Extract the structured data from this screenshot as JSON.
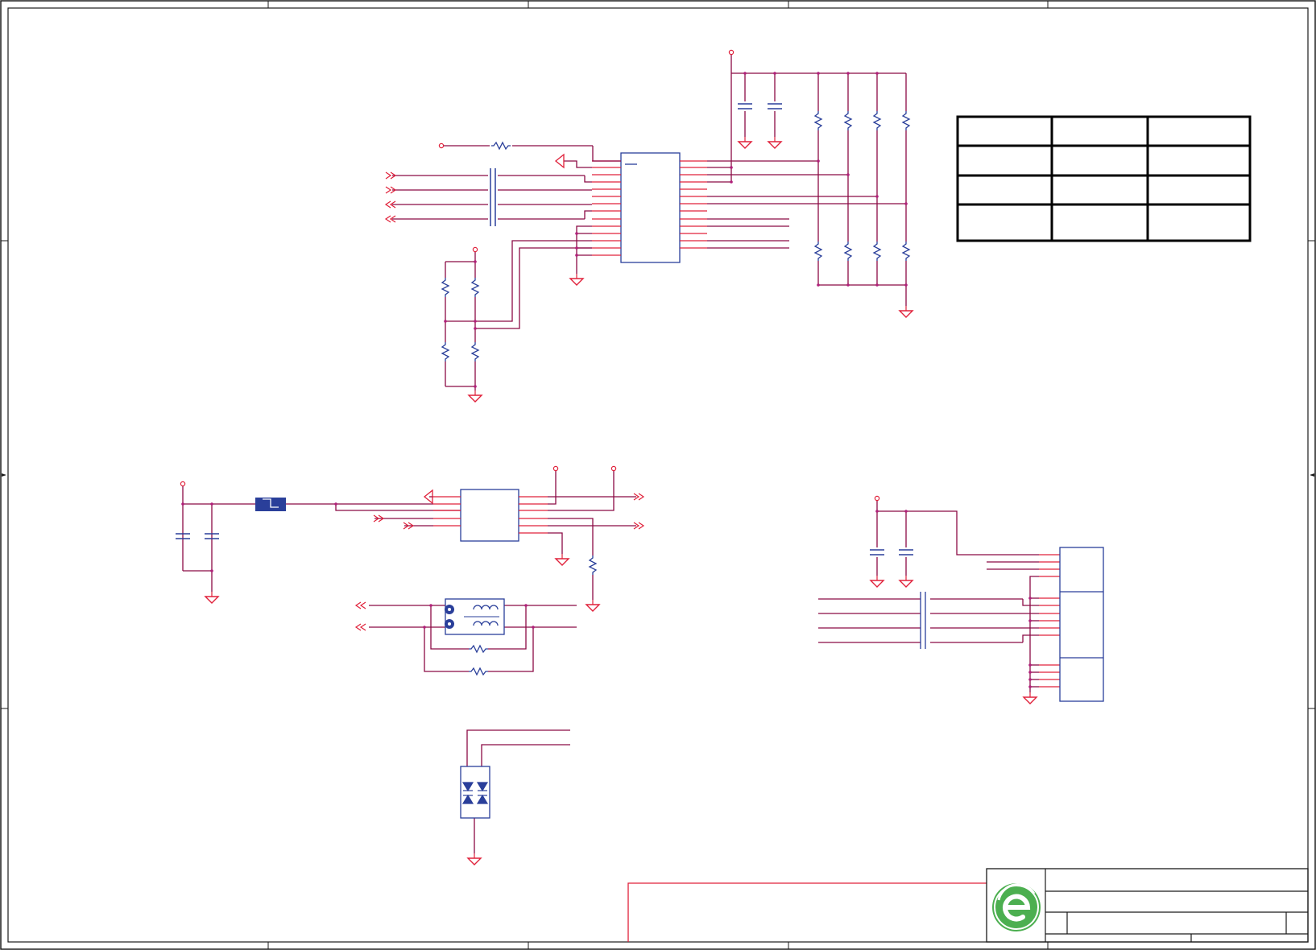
{
  "sheet": {
    "title": "",
    "frame_color": "#1a1a1a",
    "wire_color": "#8b0a45",
    "pin_color": "#e0203a",
    "component_color": "#2a3f9a",
    "junction_color": "#b0207a",
    "logo_color": "#4caf50"
  },
  "blocks": {
    "top_ic": "ic-u1",
    "bottom_ic": "ic-u2",
    "transformer": "common-mode-choke",
    "connector": "rj45-connector",
    "tvs": "tvs-diode-array",
    "ferrite": "ferrite-bead"
  },
  "info_table": {
    "rows": 4,
    "cols": 3
  },
  "title_block": {
    "logo": "company-logo-icon"
  }
}
